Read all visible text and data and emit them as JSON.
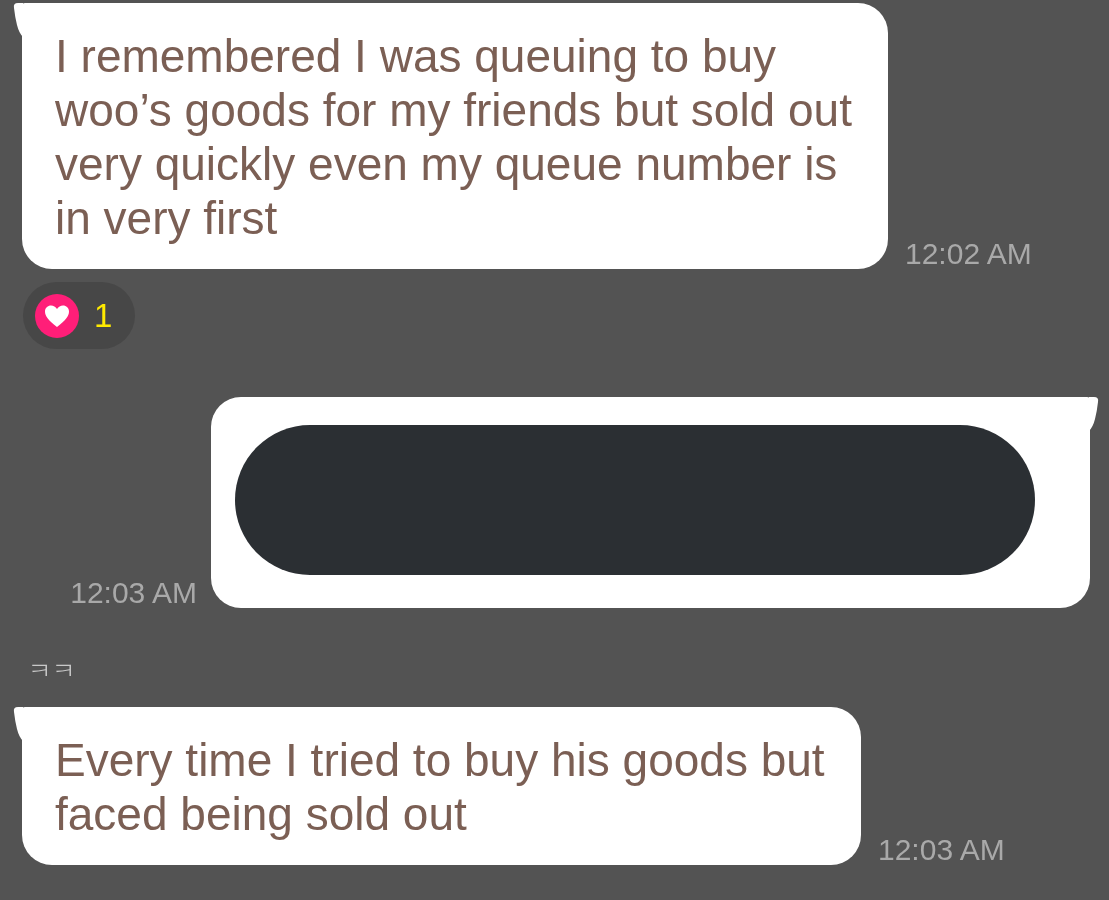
{
  "chat": {
    "messages": [
      {
        "kind": "received",
        "text": "I remembered I was queuing to buy woo’s goods for my friends but sold out very quickly even my queue number is in very first",
        "time": "12:02 AM",
        "reaction": {
          "count": "1"
        }
      },
      {
        "kind": "sent",
        "redacted": true,
        "time": "12:03 AM"
      },
      {
        "kind": "received",
        "sender": "ㅋㅋ",
        "text": "Every time I tried to buy his goods but faced being sold out",
        "time": "12:03 AM"
      }
    ]
  }
}
